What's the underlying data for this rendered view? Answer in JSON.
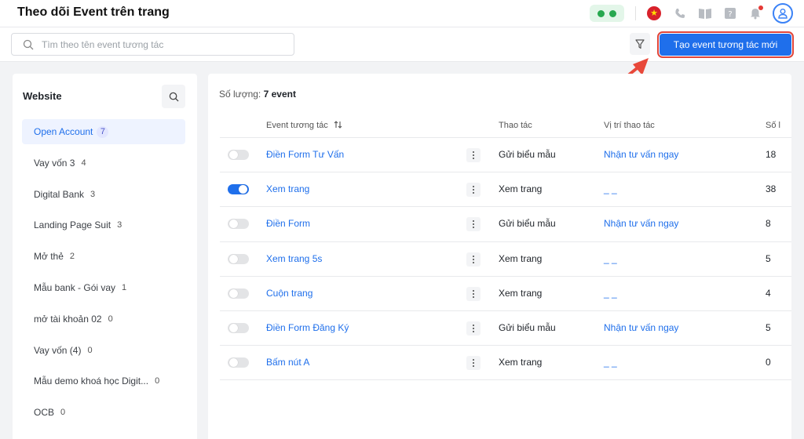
{
  "header": {
    "title": "Theo dõi Event trên trang",
    "icons": [
      "phone-icon",
      "flag-vietnam-icon",
      "call-icon",
      "book-icon",
      "help-icon",
      "bell-icon",
      "user-avatar-icon"
    ]
  },
  "toolbar": {
    "search_placeholder": "Tìm theo tên event tương tác",
    "create_label": "Tạo event tương tác mới"
  },
  "sidebar": {
    "title": "Website",
    "items": [
      {
        "label": "Open Account",
        "count": "7"
      },
      {
        "label": "Vay vốn 3",
        "count": "4"
      },
      {
        "label": "Digital Bank",
        "count": "3"
      },
      {
        "label": "Landing Page Suit",
        "count": "3"
      },
      {
        "label": "Mở thẻ",
        "count": "2"
      },
      {
        "label": "Mẫu bank - Gói vay",
        "count": "1"
      },
      {
        "label": "mở tài khoản 02",
        "count": "0"
      },
      {
        "label": "Vay vốn (4)",
        "count": "0"
      },
      {
        "label": "Mẫu demo khoá học Digit...",
        "count": "0"
      },
      {
        "label": "OCB",
        "count": "0"
      }
    ]
  },
  "main": {
    "count_label": "Số lượng:",
    "count_value": "7 event",
    "columns": {
      "name": "Event tương tác",
      "action": "Thao tác",
      "position": "Vị trí thao tác",
      "count": "Số l"
    },
    "rows": [
      {
        "enabled": false,
        "name": "Điền Form Tư Vấn",
        "action": "Gửi biểu mẫu",
        "position": "Nhận tư vấn ngay",
        "count": "18"
      },
      {
        "enabled": true,
        "name": "Xem trang",
        "action": "Xem trang",
        "position": "_ _",
        "count": "38"
      },
      {
        "enabled": false,
        "name": "Điền Form",
        "action": "Gửi biểu mẫu",
        "position": "Nhận tư vấn ngay",
        "count": "8"
      },
      {
        "enabled": false,
        "name": "Xem trang 5s",
        "action": "Xem trang",
        "position": "_ _",
        "count": "5"
      },
      {
        "enabled": false,
        "name": "Cuộn trang",
        "action": "Xem trang",
        "position": "_ _",
        "count": "4"
      },
      {
        "enabled": false,
        "name": "Điền Form Đăng Ký",
        "action": "Gửi biểu mẫu",
        "position": "Nhận tư vấn ngay",
        "count": "5"
      },
      {
        "enabled": false,
        "name": "Bấm nút A",
        "action": "Xem trang",
        "position": "_ _",
        "count": "0"
      }
    ]
  },
  "colors": {
    "accent": "#1f6feb",
    "highlight_outline": "#e0453a",
    "arrow": "#e8483a"
  }
}
